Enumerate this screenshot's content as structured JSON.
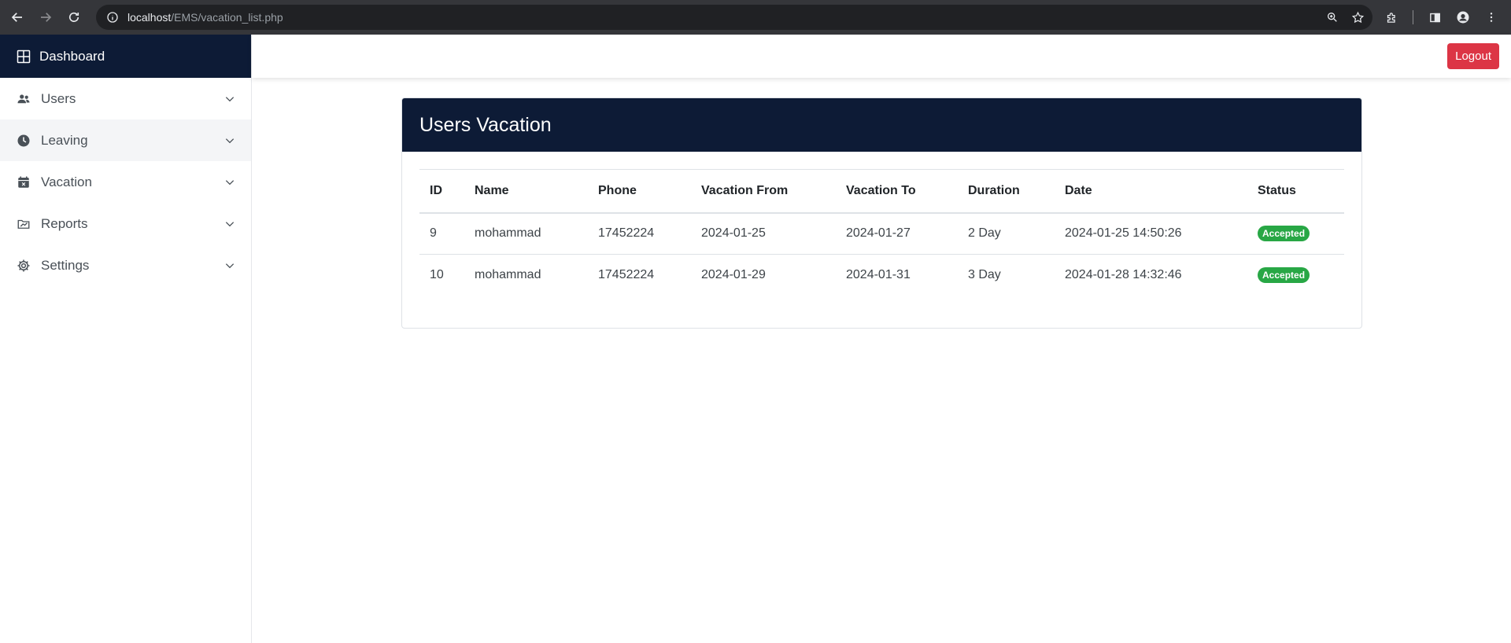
{
  "browser": {
    "url_host": "localhost",
    "url_path": "/EMS/vacation_list.php"
  },
  "sidebar": {
    "brand": "Dashboard",
    "items": [
      {
        "label": "Users",
        "icon": "users-icon"
      },
      {
        "label": "Leaving",
        "icon": "clock-icon"
      },
      {
        "label": "Vacation",
        "icon": "calendar-icon"
      },
      {
        "label": "Reports",
        "icon": "reports-icon"
      },
      {
        "label": "Settings",
        "icon": "gear-icon"
      }
    ]
  },
  "topbar": {
    "logout_label": "Logout"
  },
  "card": {
    "title": "Users Vacation",
    "columns": [
      "ID",
      "Name",
      "Phone",
      "Vacation From",
      "Vacation To",
      "Duration",
      "Date",
      "Status"
    ],
    "rows": [
      {
        "id": "9",
        "name": "mohammad",
        "phone": "17452224",
        "from": "2024-01-25",
        "to": "2024-01-27",
        "duration": "2 Day",
        "date": "2024-01-25 14:50:26",
        "status": "Accepted"
      },
      {
        "id": "10",
        "name": "mohammad",
        "phone": "17452224",
        "from": "2024-01-29",
        "to": "2024-01-31",
        "duration": "3 Day",
        "date": "2024-01-28 14:32:46",
        "status": "Accepted"
      }
    ]
  },
  "colors": {
    "navy": "#0d1b36",
    "danger": "#dc3545",
    "success": "#28a745"
  }
}
